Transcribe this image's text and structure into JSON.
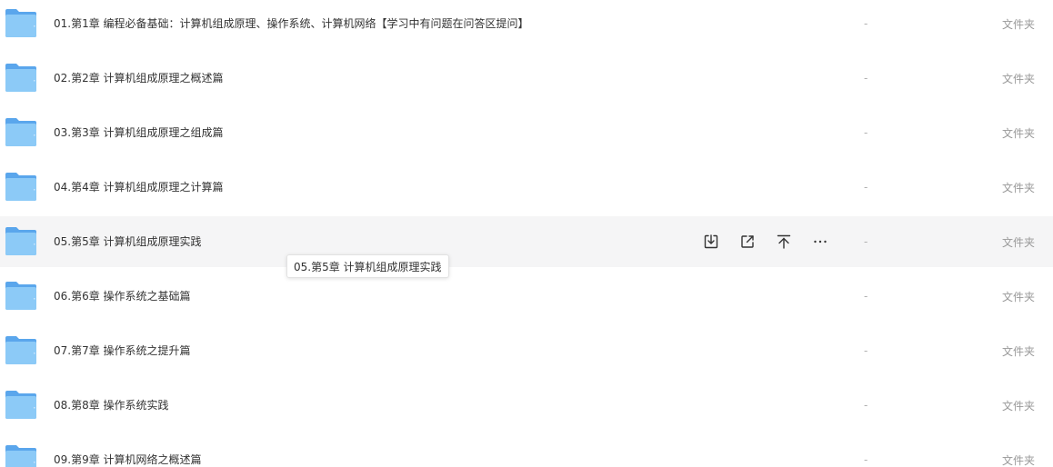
{
  "files": [
    {
      "name": "01.第1章 编程必备基础：计算机组成原理、操作系统、计算机网络【学习中有问题在问答区提问】",
      "size": "-",
      "type": "文件夹"
    },
    {
      "name": "02.第2章 计算机组成原理之概述篇",
      "size": "-",
      "type": "文件夹"
    },
    {
      "name": "03.第3章 计算机组成原理之组成篇",
      "size": "-",
      "type": "文件夹"
    },
    {
      "name": "04.第4章 计算机组成原理之计算篇",
      "size": "-",
      "type": "文件夹"
    },
    {
      "name": "05.第5章 计算机组成原理实践",
      "size": "-",
      "type": "文件夹"
    },
    {
      "name": "06.第6章 操作系统之基础篇",
      "size": "-",
      "type": "文件夹"
    },
    {
      "name": "07.第7章 操作系统之提升篇",
      "size": "-",
      "type": "文件夹"
    },
    {
      "name": "08.第8章 操作系统实践",
      "size": "-",
      "type": "文件夹"
    },
    {
      "name": "09.第9章 计算机网络之概述篇",
      "size": "-",
      "type": "文件夹"
    }
  ],
  "hovered_row": 4,
  "tooltip": {
    "text": "05.第5章 计算机组成原理实践"
  },
  "row_actions": [
    {
      "icon": "download-icon"
    },
    {
      "icon": "share-icon"
    },
    {
      "icon": "move-to-top-icon"
    },
    {
      "icon": "more-icon"
    }
  ],
  "colors": {
    "folder": "#6cb4f0",
    "hover_bg": "#f5f5f6",
    "text": "#333333",
    "muted": "#999999"
  }
}
